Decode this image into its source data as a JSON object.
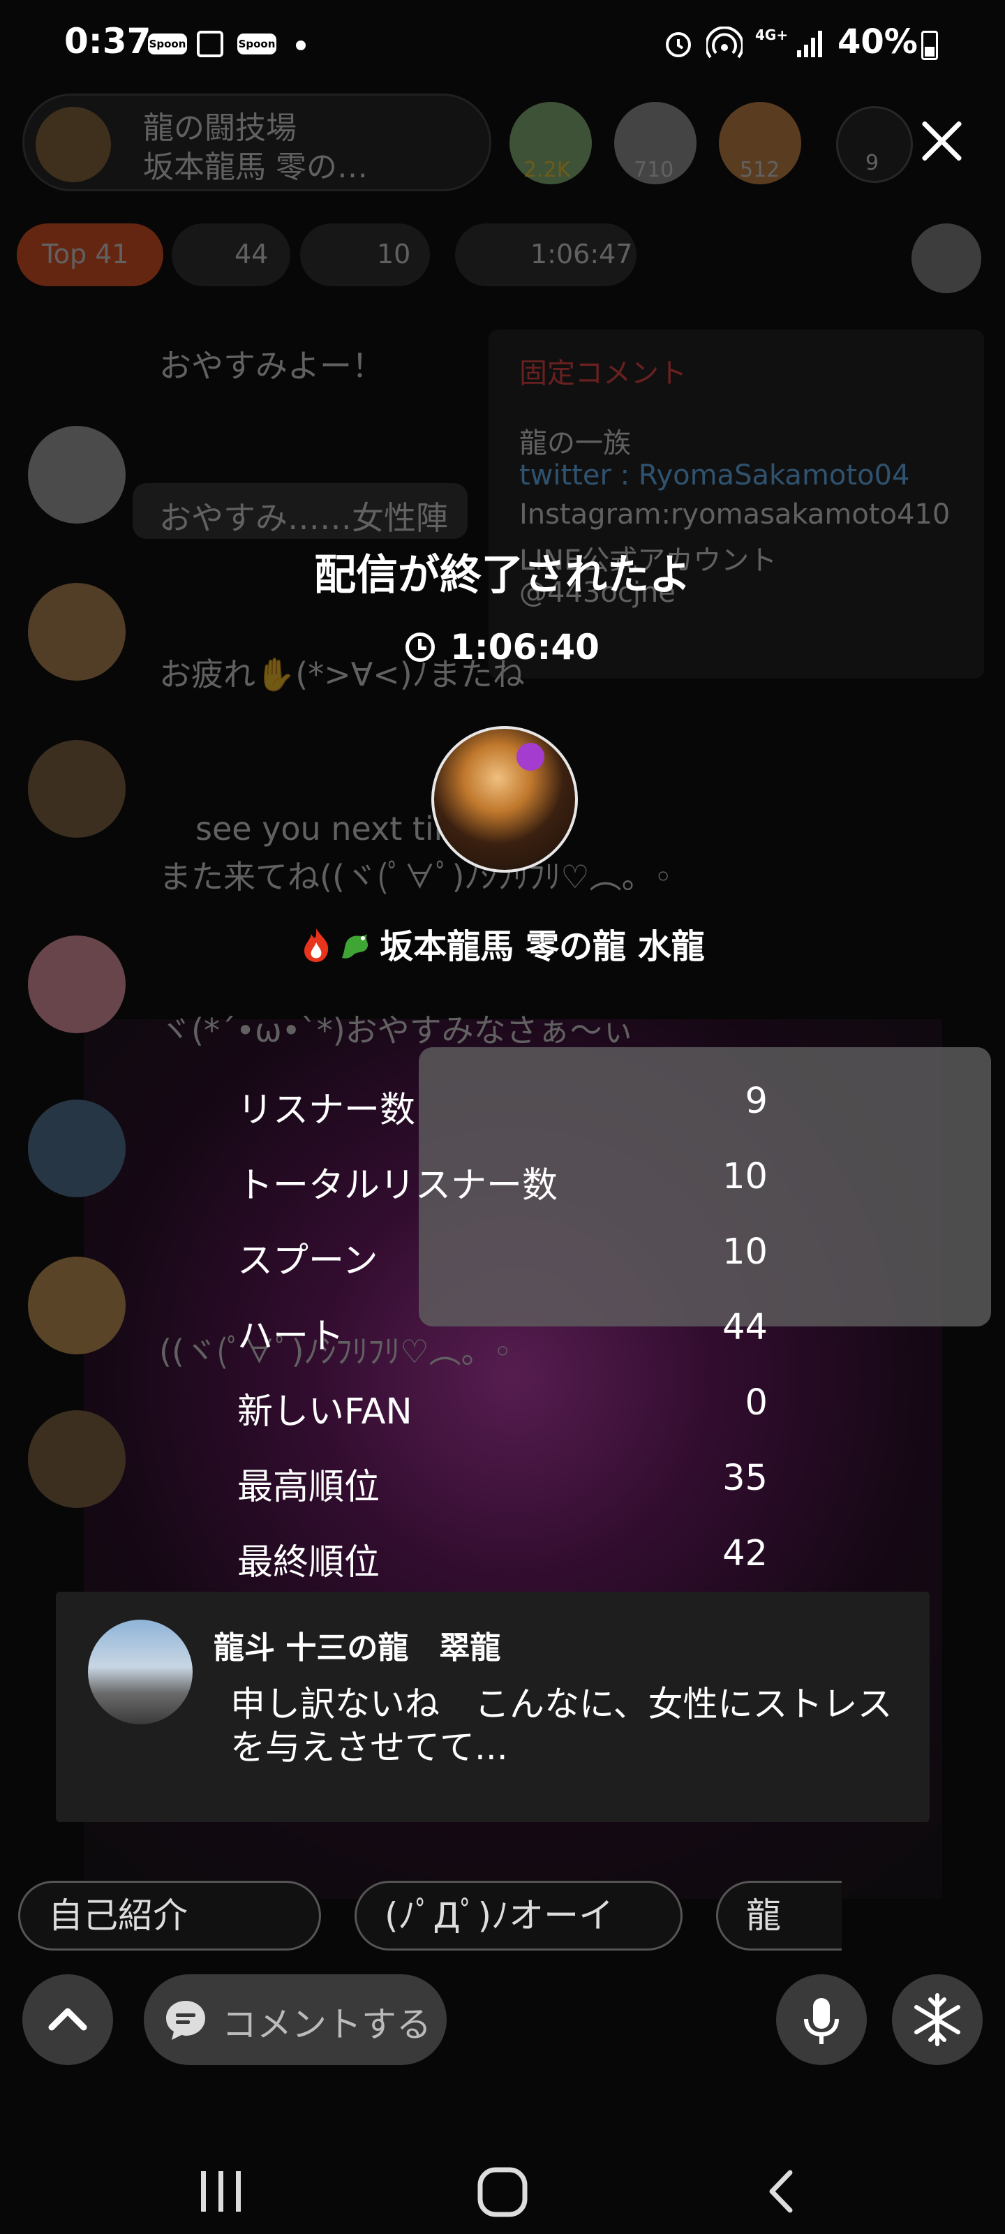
{
  "status_bar": {
    "time": "0:37",
    "app_icon_label": "Spoon",
    "network": "4G+",
    "battery": "40%"
  },
  "background": {
    "room_title_line1": "龍の闘技場",
    "room_title_line2": "坂本龍馬 零の…",
    "rank_badges": [
      "2.2K",
      "710",
      "512"
    ],
    "listener_count": "9",
    "top_label": "Top 41",
    "hearts": "44",
    "gifts": "10",
    "elapsed": "1:06:47",
    "pinned_title": "固定コメント",
    "pinned_lines": [
      "龍の一族",
      "twitter : RyomaSakamoto04",
      "Instagram:ryomasakamoto410",
      "LINE公式アカウント",
      "@443ocjne"
    ],
    "chat_lines": [
      "おやすみよー！",
      "おやすみ……女性陣",
      "お疲れ✋(*>∀<)ﾉまたね",
      "see you next time",
      "また来てね((ヾ(ﾟ∀ﾟ)ﾉｼﾌﾘﾌﾘ♡︵。◦",
      "ヾ(*ˊ•ω•ˋ*)おやすみなさぁ〜ぃ",
      "((ヾ(ﾟ∀ﾟ)ﾉｼﾌﾘﾌﾘ♡︵。◦"
    ]
  },
  "summary": {
    "title": "配信が終了されたよ",
    "duration": "1:06:40",
    "dj_name": "坂本龍馬 零の龍 水龍",
    "stats": [
      {
        "label": "リスナー数",
        "value": "9"
      },
      {
        "label": "トータルリスナー数",
        "value": "10"
      },
      {
        "label": "スプーン",
        "value": "10"
      },
      {
        "label": "ハート",
        "value": "44"
      },
      {
        "label": "新しいFAN",
        "value": "0"
      },
      {
        "label": "最高順位",
        "value": "35"
      },
      {
        "label": "最終順位",
        "value": "42"
      }
    ]
  },
  "toast": {
    "name": "龍斗 十三の龍　翠龍",
    "text": "申し訳ないね　こんなに、女性にストレスを与えさせてて..."
  },
  "bottom": {
    "shortcuts": [
      "自己紹介",
      "(ﾉﾟДﾟ)ﾉオーイ",
      "龍"
    ],
    "comment_placeholder": "コメントする"
  }
}
